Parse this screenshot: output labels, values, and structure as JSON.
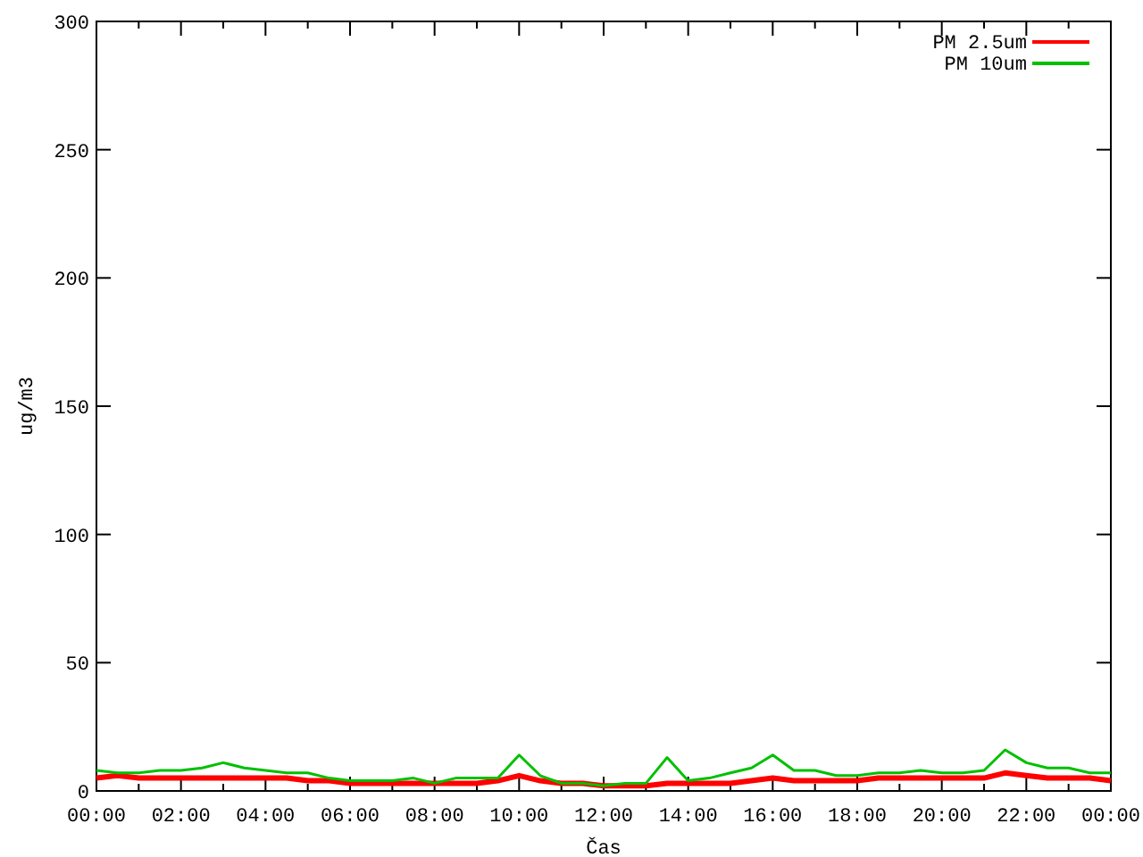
{
  "chart_data": {
    "type": "line",
    "xlabel": "Čas",
    "ylabel": "ug/m3",
    "x": [
      0,
      0.5,
      1,
      1.5,
      2,
      2.5,
      3,
      3.5,
      4,
      4.5,
      5,
      5.5,
      6,
      6.5,
      7,
      7.5,
      8,
      8.5,
      9,
      9.5,
      10,
      10.5,
      11,
      11.5,
      12,
      12.5,
      13,
      13.5,
      14,
      14.5,
      15,
      15.5,
      16,
      16.5,
      17,
      17.5,
      18,
      18.5,
      19,
      19.5,
      20,
      20.5,
      21,
      21.5,
      22,
      22.5,
      23,
      23.5,
      24
    ],
    "series": [
      {
        "name": "PM 2.5um",
        "color": "#ff0000",
        "values": [
          5,
          6,
          5,
          5,
          5,
          5,
          5,
          5,
          5,
          5,
          4,
          4,
          3,
          3,
          3,
          3,
          3,
          3,
          3,
          4,
          6,
          4,
          3,
          3,
          2,
          2,
          2,
          3,
          3,
          3,
          3,
          4,
          5,
          4,
          4,
          4,
          4,
          5,
          5,
          5,
          5,
          5,
          5,
          7,
          6,
          5,
          5,
          5,
          4
        ]
      },
      {
        "name": "PM 10um",
        "color": "#00c000",
        "values": [
          8,
          7,
          7,
          8,
          8,
          9,
          11,
          9,
          8,
          7,
          7,
          5,
          4,
          4,
          4,
          5,
          3,
          5,
          5,
          5,
          14,
          6,
          3,
          3,
          2,
          3,
          3,
          13,
          4,
          5,
          7,
          9,
          14,
          8,
          8,
          6,
          6,
          7,
          7,
          8,
          7,
          7,
          8,
          16,
          11,
          9,
          9,
          7,
          7
        ]
      }
    ],
    "xlim": [
      0,
      24
    ],
    "ylim": [
      0,
      300
    ],
    "xticks": [
      {
        "value": 0,
        "label": "00:00"
      },
      {
        "value": 2,
        "label": "02:00"
      },
      {
        "value": 4,
        "label": "04:00"
      },
      {
        "value": 6,
        "label": "06:00"
      },
      {
        "value": 8,
        "label": "08:00"
      },
      {
        "value": 10,
        "label": "10:00"
      },
      {
        "value": 12,
        "label": "12:00"
      },
      {
        "value": 14,
        "label": "14:00"
      },
      {
        "value": 16,
        "label": "16:00"
      },
      {
        "value": 18,
        "label": "18:00"
      },
      {
        "value": 20,
        "label": "20:00"
      },
      {
        "value": 22,
        "label": "22:00"
      },
      {
        "value": 24,
        "label": "00:00"
      }
    ],
    "yticks": [
      0,
      50,
      100,
      150,
      200,
      250,
      300
    ],
    "legend": "upper right"
  }
}
